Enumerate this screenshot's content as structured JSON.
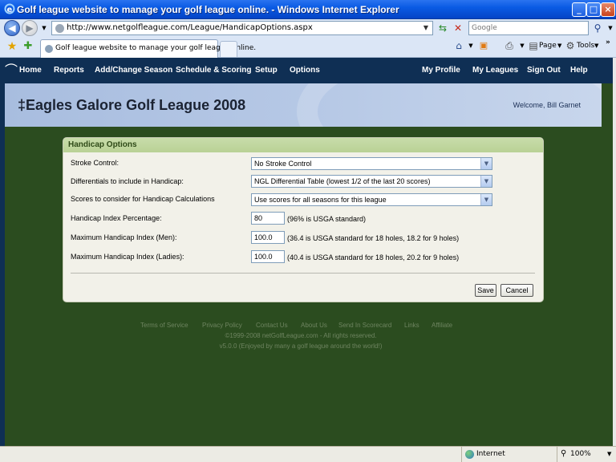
{
  "window": {
    "title": "Golf league website to manage your golf league online. - Windows Internet Explorer",
    "buttons": {
      "minimize": "_",
      "maximize": "□",
      "close": "×"
    }
  },
  "browser": {
    "url": "http://www.netgolfleague.com/League/HandicapOptions.aspx",
    "search_placeholder": "Google",
    "tab_title": "Golf league website to manage your golf league online.",
    "commands": {
      "page": "Page",
      "tools": "Tools",
      "more": "»"
    }
  },
  "site_nav": {
    "left": [
      "Home",
      "Reports",
      "Add/Change Season",
      "Schedule & Scoring",
      "Setup",
      "Options"
    ],
    "right": [
      "My Profile",
      "My Leagues",
      "Sign Out",
      "Help"
    ]
  },
  "banner": {
    "league_name": "‡Eagles Galore Golf League 2008",
    "welcome": "Welcome, Bill Garnet"
  },
  "form": {
    "heading": "Handicap Options",
    "stroke_control": {
      "label": "Stroke Control:",
      "value": "No Stroke Control"
    },
    "differentials": {
      "label": "Differentials to include in Handicap:",
      "value": "NGL Differential Table (lowest 1/2 of the last 20 scores)"
    },
    "scores": {
      "label": "Scores to consider for Handicap Calculations",
      "value": "Use scores for all seasons for this league"
    },
    "index_percentage": {
      "label": "Handicap Index Percentage:",
      "value": "80",
      "hint": "(96% is USGA standard)"
    },
    "max_men": {
      "label": "Maximum Handicap Index (Men):",
      "value": "100.0",
      "hint": "(36.4 is USGA standard for 18 holes, 18.2 for 9 holes)"
    },
    "max_ladies": {
      "label": "Maximum Handicap Index (Ladies):",
      "value": "100.0",
      "hint": "(40.4 is USGA standard for 18 holes, 20.2 for 9 holes)"
    },
    "save_label": "Save",
    "cancel_label": "Cancel"
  },
  "footer": {
    "links": [
      "Terms of Service",
      "Privacy Policy",
      "Contact Us",
      "About Us",
      "Send In Scorecard",
      "Links",
      "Affiliate"
    ],
    "copyright": "©1999-2008 netGolfLeague.com - All rights reserved.",
    "version": "v5.0.0 (Enjoyed by many a golf league around the world!)"
  },
  "statusbar": {
    "zone": "Internet",
    "zoom": "100%"
  },
  "colors": {
    "nav_bg": "#0f2f54",
    "page_bg": "#2b4c1f",
    "panel_header": "#c8dcaa",
    "banner": "#b7c9e6"
  }
}
